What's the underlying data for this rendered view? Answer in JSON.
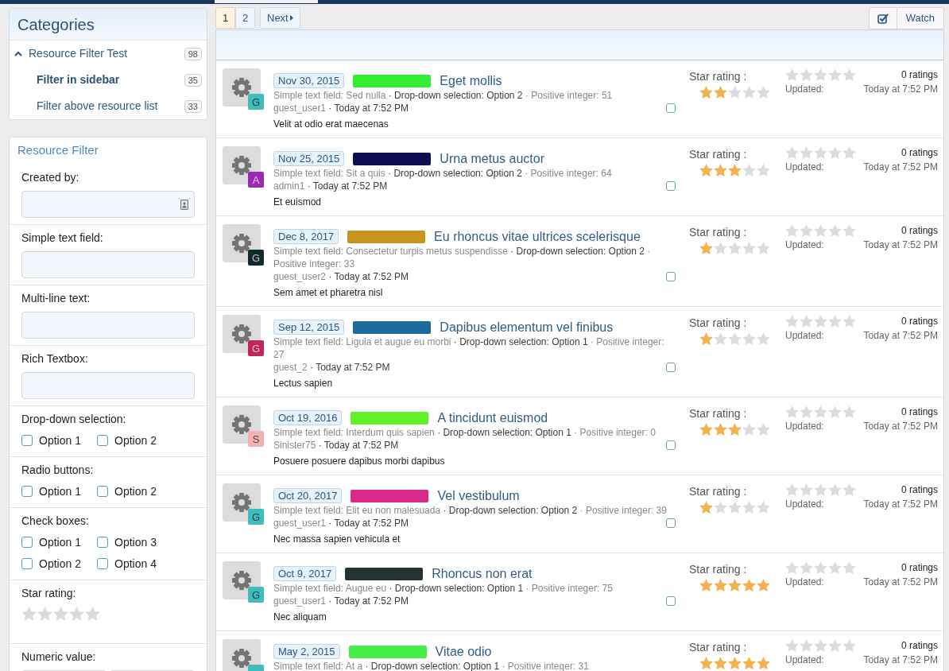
{
  "categories": {
    "title": "Categories",
    "items": [
      {
        "label": "Resource Filter Test",
        "count": "98",
        "expanded": true,
        "selected": false,
        "children": [
          {
            "label": "Filter in sidebar",
            "count": "35",
            "selected": true
          },
          {
            "label": "Filter above resource list",
            "count": "33",
            "selected": false
          }
        ]
      }
    ]
  },
  "filter": {
    "title": "Resource Filter",
    "sections": [
      {
        "kind": "user",
        "label": "Created by:"
      },
      {
        "kind": "text",
        "label": "Simple text field:"
      },
      {
        "kind": "text",
        "label": "Multi-line text:"
      },
      {
        "kind": "text",
        "label": "Rich Textbox:"
      },
      {
        "kind": "choices",
        "label": "Drop-down selection:",
        "options": [
          {
            "label": "Option 1",
            "checked": false
          },
          {
            "label": "Option 2",
            "checked": false
          }
        ]
      },
      {
        "kind": "choices",
        "label": "Radio buttons:",
        "options": [
          {
            "label": "Option 1",
            "checked": false
          },
          {
            "label": "Option 2",
            "checked": false
          }
        ]
      },
      {
        "kind": "choices",
        "label": "Check boxes:",
        "options": [
          {
            "label": "Option 1",
            "checked": false
          },
          {
            "label": "Option 3",
            "checked": false
          },
          {
            "label": "Option 2",
            "checked": false
          },
          {
            "label": "Option 4",
            "checked": false
          }
        ]
      },
      {
        "kind": "stars",
        "label": "Star rating:",
        "stars": 0
      },
      {
        "kind": "range",
        "label": "Numeric value:"
      }
    ]
  },
  "pagination": {
    "pages": [
      {
        "label": "1",
        "selected": true
      },
      {
        "label": "2",
        "selected": false
      }
    ],
    "next": "Next"
  },
  "watch": {
    "label": "Watch"
  },
  "resources": [
    {
      "date": "Nov 30, 2015",
      "color": "#33ee33",
      "title": "Eget mollis",
      "avatar": {
        "letter": "G",
        "color": "#3fbcbc"
      },
      "fields": [
        {
          "kind": "text",
          "text": "Simple text field: Sed nulla"
        },
        {
          "kind": "choice",
          "text": "· Drop-down selection: Option 2"
        },
        {
          "kind": "number",
          "text": "· Positive integer: 51"
        }
      ],
      "author": "guest_user1",
      "time": "· Today at 7:52 PM",
      "snippet": "Velit at odio erat maecenas",
      "checked": false,
      "star_label": "Star rating :",
      "user_rating": {
        "stars": 2
      },
      "rating": {
        "stars": 0
      },
      "rating_count": "0 ratings",
      "updated_label": "Updated:",
      "updated": "Today at 7:52 PM"
    },
    {
      "date": "Nov 25, 2015",
      "color": "#0d0d4f",
      "title": "Urna metus auctor",
      "avatar": {
        "letter": "A",
        "color": "#9c27b0"
      },
      "fields": [
        {
          "kind": "text",
          "text": "Simple text field: Sit a quis"
        },
        {
          "kind": "choice",
          "text": "· Drop-down selection: Option 2"
        },
        {
          "kind": "number",
          "text": "· Positive integer: 64"
        }
      ],
      "author": "admin1",
      "time": "· Today at 7:52 PM",
      "snippet": "Et euismod",
      "checked": false,
      "star_label": "Star rating :",
      "user_rating": {
        "stars": 3
      },
      "rating": {
        "stars": 0
      },
      "rating_count": "0 ratings",
      "updated_label": "Updated:",
      "updated": "Today at 7:52 PM"
    },
    {
      "date": "Dec 8, 2017",
      "color": "#c8941e",
      "title": "Eu rhoncus vitae ultrices scelerisque",
      "avatar": {
        "letter": "G",
        "color": "#0f2b2b"
      },
      "fields": [
        {
          "kind": "text",
          "text": "Simple text field: Consectetur turpis metus suspendisse"
        },
        {
          "kind": "choice",
          "text": "· Drop-down selection: Option 2"
        },
        {
          "kind": "number",
          "text": "· Positive integer: 33"
        }
      ],
      "author": "guest_user2",
      "time": "· Today at 7:52 PM",
      "snippet": "Sem amet et pharetra nisl",
      "checked": false,
      "star_label": "Star rating :",
      "user_rating": {
        "stars": 1
      },
      "rating": {
        "stars": 0
      },
      "rating_count": "0 ratings",
      "updated_label": "Updated:",
      "updated": "Today at 7:52 PM"
    },
    {
      "date": "Sep 12, 2015",
      "color": "#1d6a9c",
      "title": "Dapibus elementum vel finibus",
      "avatar": {
        "letter": "G",
        "color": "#c2255c"
      },
      "fields": [
        {
          "kind": "text",
          "text": "Simple text field: Ligula et augue eu morbi"
        },
        {
          "kind": "choice",
          "text": "· Drop-down selection: Option 1"
        },
        {
          "kind": "number",
          "text": "· Positive integer: 27"
        }
      ],
      "author": "guest_2",
      "time": "· Today at 7:52 PM",
      "snippet": "Lectus sapien",
      "checked": false,
      "star_label": "Star rating :",
      "user_rating": {
        "stars": 1
      },
      "rating": {
        "stars": 0
      },
      "rating_count": "0 ratings",
      "updated_label": "Updated:",
      "updated": "Today at 7:52 PM"
    },
    {
      "date": "Oct 19, 2016",
      "color": "#62f02a",
      "title": "A tincidunt euismod",
      "avatar": {
        "letter": "S",
        "color": "#f2b3b3"
      },
      "fields": [
        {
          "kind": "text",
          "text": "Simple text field: Interdum quis sapien"
        },
        {
          "kind": "choice",
          "text": "· Drop-down selection: Option 1"
        },
        {
          "kind": "number",
          "text": "· Positive integer: 0"
        }
      ],
      "author": "Sinister75",
      "time": "· Today at 7:52 PM",
      "snippet": "Posuere posuere dapibus morbi dapibus",
      "checked": false,
      "star_label": "Star rating :",
      "user_rating": {
        "stars": 3
      },
      "rating": {
        "stars": 0
      },
      "rating_count": "0 ratings",
      "updated_label": "Updated:",
      "updated": "Today at 7:52 PM"
    },
    {
      "date": "Oct 20, 2017",
      "color": "#d92a8c",
      "title": "Vel vestibulum",
      "avatar": {
        "letter": "G",
        "color": "#3fbcbc"
      },
      "fields": [
        {
          "kind": "text",
          "text": "Simple text field: Elit eu non malesuada"
        },
        {
          "kind": "choice",
          "text": "· Drop-down selection: Option 2"
        },
        {
          "kind": "number",
          "text": "· Positive integer: 39"
        }
      ],
      "author": "guest_user1",
      "time": "· Today at 7:52 PM",
      "snippet": "Nec massa sapien vehicula et",
      "checked": false,
      "star_label": "Star rating :",
      "user_rating": {
        "stars": 1
      },
      "rating": {
        "stars": 0
      },
      "rating_count": "0 ratings",
      "updated_label": "Updated:",
      "updated": "Today at 7:52 PM"
    },
    {
      "date": "Oct 9, 2017",
      "color": "#243333",
      "title": "Rhoncus non erat",
      "avatar": {
        "letter": "G",
        "color": "#3fbcbc"
      },
      "fields": [
        {
          "kind": "text",
          "text": "Simple text field: Augue eu"
        },
        {
          "kind": "choice",
          "text": "· Drop-down selection: Option 1"
        },
        {
          "kind": "number",
          "text": "· Positive integer: 75"
        }
      ],
      "author": "guest_user1",
      "time": "· Today at 7:52 PM",
      "snippet": "Nec aliquam",
      "checked": false,
      "star_label": "Star rating :",
      "user_rating": {
        "stars": 5
      },
      "rating": {
        "stars": 0
      },
      "rating_count": "0 ratings",
      "updated_label": "Updated:",
      "updated": "Today at 7:52 PM"
    },
    {
      "date": "May 2, 2015",
      "color": "#44ee44",
      "title": "Vitae odio",
      "avatar": {
        "color": "#3fbcbc"
      },
      "fields": [
        {
          "kind": "text",
          "text": "Simple text field: At a"
        },
        {
          "kind": "choice",
          "text": "· Drop-down selection: Option 1"
        },
        {
          "kind": "number",
          "text": "· Positive integer: 31"
        }
      ],
      "star_label": "Star rating :",
      "user_rating": {
        "stars": 5
      },
      "rating": {
        "stars": 0
      },
      "rating_count": "0 ratings",
      "updated_label": "Updated:",
      "updated": "Today at 7:52 PM"
    }
  ]
}
